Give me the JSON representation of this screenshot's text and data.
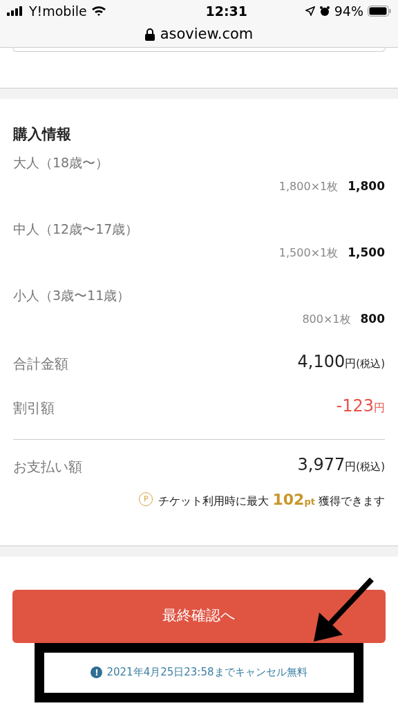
{
  "status_bar": {
    "carrier": "Y!mobile",
    "time": "12:31",
    "battery": "94%"
  },
  "browser": {
    "url": "asoview.com"
  },
  "purchase": {
    "title": "購入情報",
    "tickets": [
      {
        "label": "大人（18歳〜）",
        "unit_price": "1,800×1枚",
        "subtotal": "1,800"
      },
      {
        "label": "中人（12歳〜17歳）",
        "unit_price": "1,500×1枚",
        "subtotal": "1,500"
      },
      {
        "label": "小人（3歳〜11歳）",
        "unit_price": "800×1枚",
        "subtotal": "800"
      }
    ],
    "summary": [
      {
        "kind": "total",
        "label": "合計金額",
        "amount": "4,100",
        "currency": "円",
        "tax": "(税込)"
      },
      {
        "kind": "discount",
        "label": "割引額",
        "amount": "-123",
        "currency": "円"
      },
      {
        "kind": "payment",
        "label": "お支払い額",
        "amount": "3,977",
        "currency": "円",
        "tax": "(税込)"
      }
    ],
    "points": {
      "icon": "P",
      "prefix": "チケット利用時に最大",
      "value": "102",
      "unit": "pt",
      "suffix": "獲得できます"
    }
  },
  "confirm_button": "最終確認へ",
  "cancel_note": {
    "icon": "!",
    "text": "2021年4月25日23:58までキャンセル無料"
  }
}
